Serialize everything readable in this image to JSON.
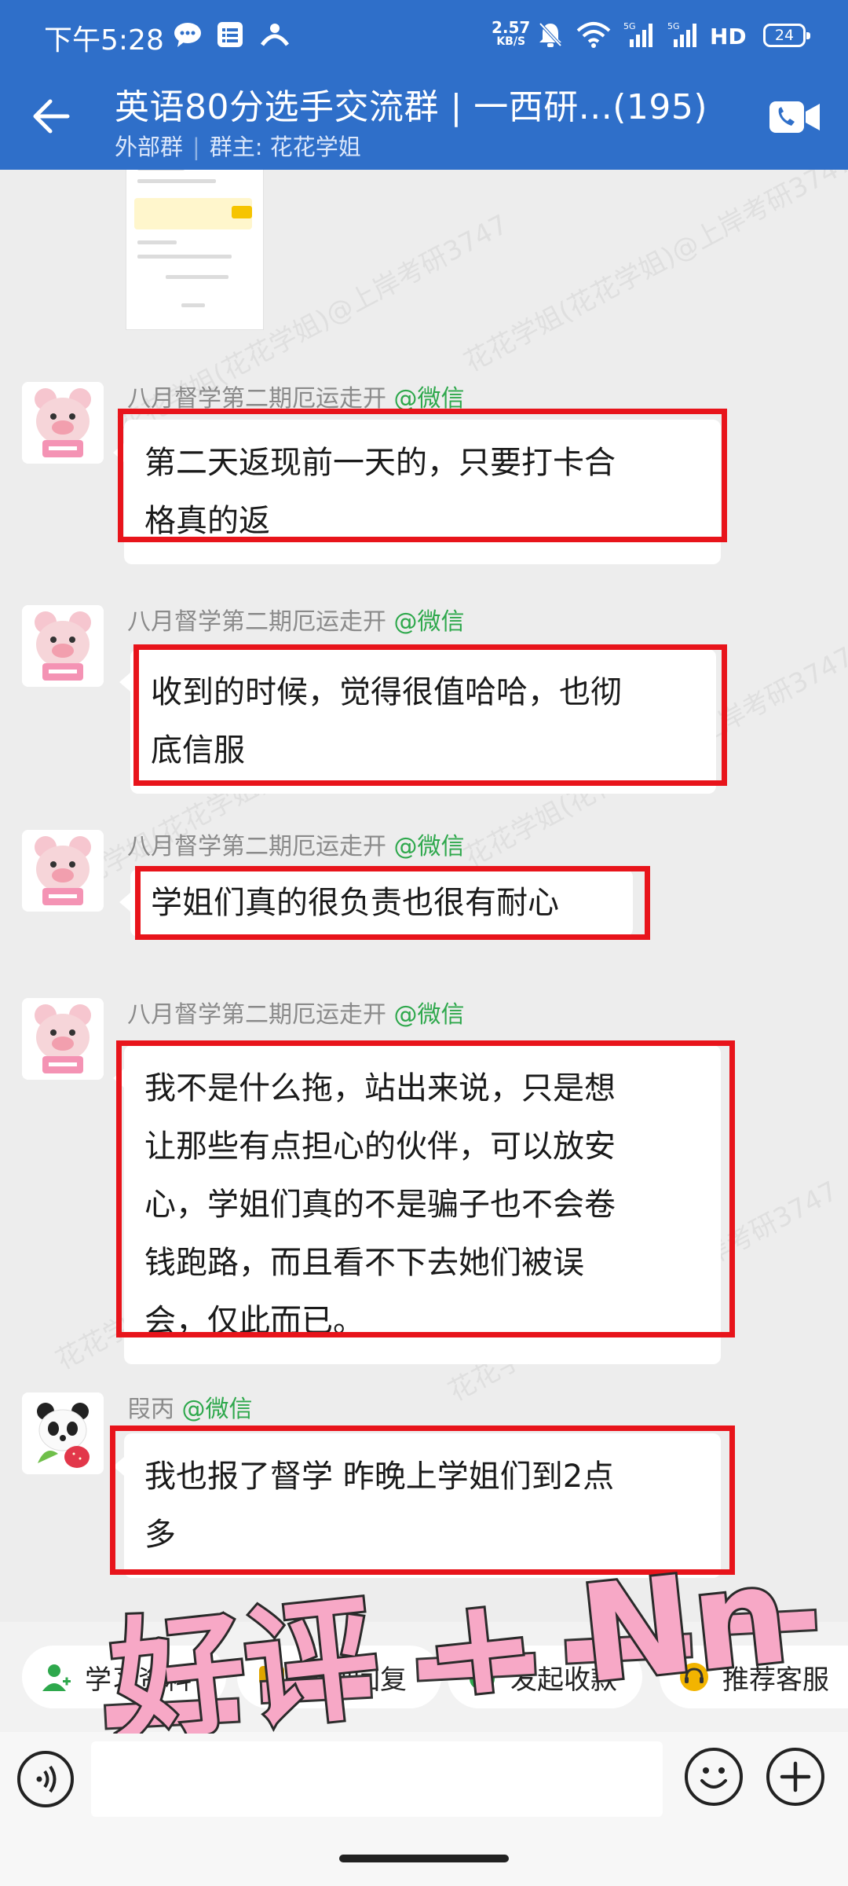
{
  "status_bar": {
    "time": "下午5:28",
    "net_speed_top": "2.57",
    "net_speed_unit": "KB/S",
    "net_type": "HD",
    "battery": "24"
  },
  "header": {
    "title": "英语80分选手交流群 | 一西研...(195)",
    "sub_label": "外部群",
    "owner_label": "群主: 花花学姐"
  },
  "watermark_text": "花花学姐(花花学姐)@上岸考研3747",
  "messages": [
    {
      "sender": "八月督学第二期厄运走开",
      "tag": "@微信",
      "lines": [
        "第二天返现前一天的，只要打卡合",
        "格真的返"
      ]
    },
    {
      "sender": "八月督学第二期厄运走开",
      "tag": "@微信",
      "lines": [
        "收到的时候，觉得很值哈哈，也彻",
        "底信服"
      ]
    },
    {
      "sender": "八月督学第二期厄运走开",
      "tag": "@微信",
      "lines": [
        "学姐们真的很负责也很有耐心"
      ]
    },
    {
      "sender": "八月督学第二期厄运走开",
      "tag": "@微信",
      "lines": [
        "我不是什么拖，站出来说，只是想",
        "让那些有点担心的伙伴，可以放安",
        "心，学姐们真的不是骗子也不会卷",
        "钱跑路，而且看不下去她们被误",
        "会，仅此而已。"
      ]
    },
    {
      "sender": "叚丙",
      "tag": "@微信",
      "lines": [
        "我也报了督学 昨晚上学姐们到2点",
        "多"
      ]
    }
  ],
  "quick_actions": [
    {
      "label": "学习资料",
      "icon": "person-icon",
      "color": "#2ea84c"
    },
    {
      "label": "快捷回复",
      "icon": "reply-icon",
      "color": "#e0a500"
    },
    {
      "label": "发起收款",
      "icon": "yuan-icon",
      "color": "#2ea84c"
    },
    {
      "label": "推荐客服",
      "icon": "service-icon",
      "color": "#f2b400"
    }
  ],
  "input": {
    "placeholder": ""
  },
  "overlay": {
    "text": "好评 + Nn"
  },
  "colors": {
    "header_bg": "#2f6fc9",
    "highlight_red": "#e8141b",
    "tag_green": "#2ea84c",
    "stamp_pink": "#f7a8c6"
  }
}
